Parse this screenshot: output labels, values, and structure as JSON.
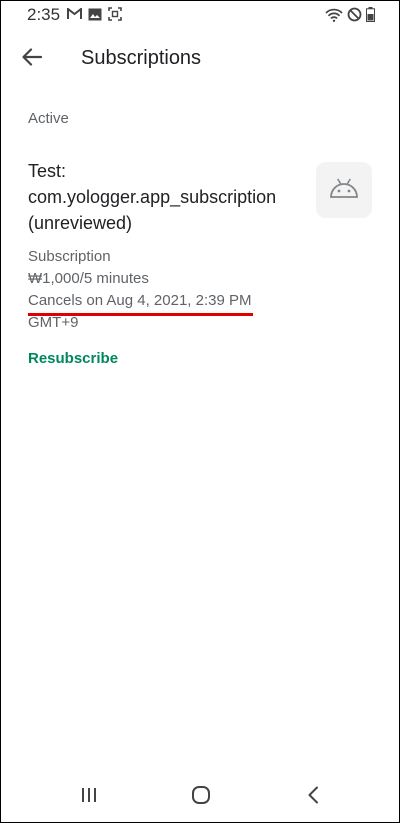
{
  "status_bar": {
    "time": "2:35",
    "left_icons": [
      "gmail-icon",
      "gallery-icon",
      "screenshot-icon"
    ],
    "right_icons": [
      "wifi-icon",
      "dnd-icon",
      "battery-icon"
    ]
  },
  "app_bar": {
    "title": "Subscriptions",
    "back_icon": "arrow-back-icon"
  },
  "section": {
    "label": "Active"
  },
  "subscription": {
    "name": "Test: com.yologger.app_subscription (unreviewed)",
    "type": "Subscription",
    "price": "₩1,000/5 minutes",
    "cancel_info": "Cancels on Aug 4, 2021, 2:39 PM",
    "timezone": "GMT+9",
    "icon": "android-icon",
    "action_label": "Resubscribe"
  },
  "nav_bar": {
    "items": [
      "recents-icon",
      "home-icon",
      "back-icon"
    ]
  },
  "colors": {
    "accent": "#01875f",
    "annotation": "#e00000",
    "secondary_text": "#5f6368"
  }
}
